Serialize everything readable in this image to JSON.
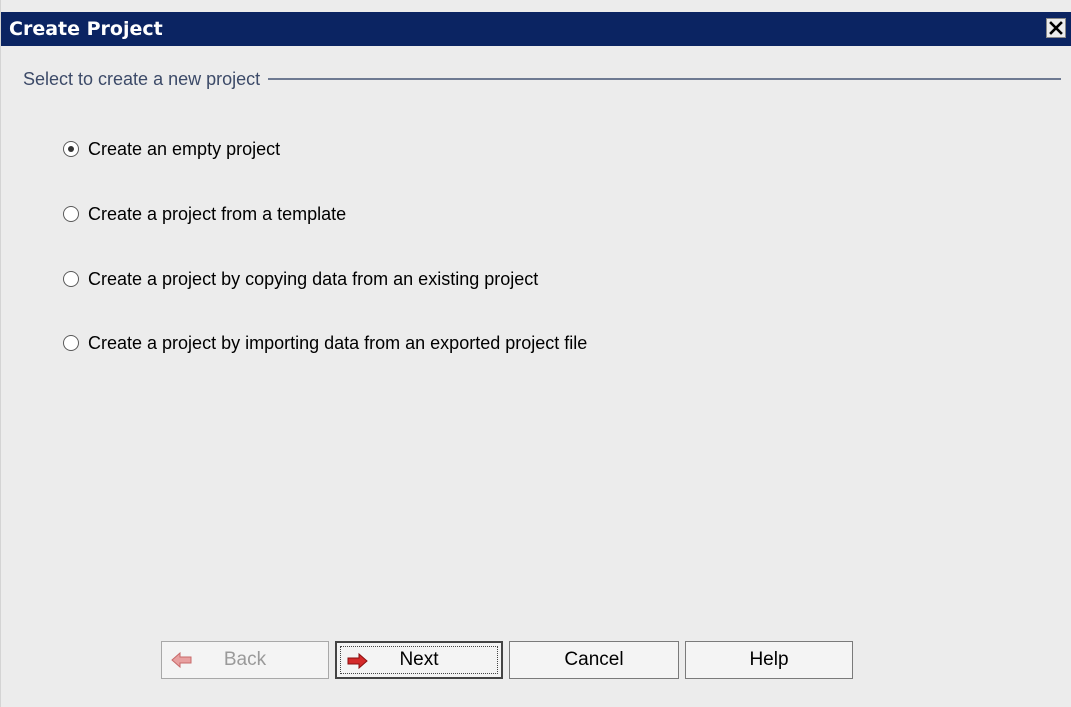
{
  "window": {
    "title": "Create Project",
    "close_icon": "close-icon"
  },
  "group": {
    "label": "Select to create a new project"
  },
  "options": [
    {
      "label": "Create an empty project",
      "selected": true
    },
    {
      "label": "Create a project from a template",
      "selected": false
    },
    {
      "label": "Create a project by copying data from an existing project",
      "selected": false
    },
    {
      "label": "Create a project by importing data from an exported project file",
      "selected": false
    }
  ],
  "buttons": {
    "back": {
      "label": "Back",
      "icon": "arrow-left-icon",
      "enabled": false
    },
    "next": {
      "label": "Next",
      "icon": "arrow-right-icon",
      "enabled": true
    },
    "cancel": {
      "label": "Cancel"
    },
    "help": {
      "label": "Help"
    }
  },
  "colors": {
    "titlebar": "#0b2462",
    "arrow_red": "#d42a2a",
    "dialog_bg": "#ececec"
  }
}
